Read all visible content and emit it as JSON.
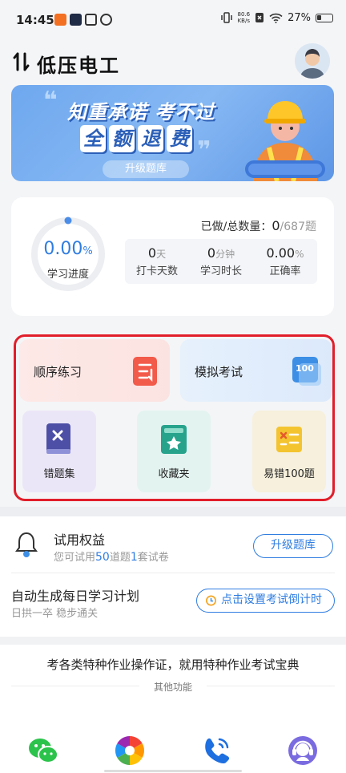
{
  "status_bar": {
    "time": "14:45",
    "speed_value": "80.6",
    "speed_unit": "KB/s",
    "battery": "27%"
  },
  "header": {
    "title": "低压电工"
  },
  "banner": {
    "line1": "知重承诺 考不过",
    "line2": [
      "全",
      "额",
      "退",
      "费"
    ],
    "button": "升级题库"
  },
  "progress": {
    "percent_value": "0.00",
    "percent_unit": "%",
    "label": "学习进度",
    "count_label": "已做/总数量：",
    "done": "0",
    "total": "/687题",
    "stats": [
      {
        "value": "0",
        "unit": "天",
        "label": "打卡天数"
      },
      {
        "value": "0",
        "unit": "分钟",
        "label": "学习时长"
      },
      {
        "value": "0.00",
        "unit": "%",
        "label": "正确率"
      }
    ]
  },
  "modules": {
    "sequential": "顺序练习",
    "mock_exam": "模拟考试",
    "wrong_set": "错题集",
    "favorites": "收藏夹",
    "easy_wrong": "易错100题"
  },
  "trial": {
    "title": "试用权益",
    "sub_prefix": "您可试用",
    "sub_questions": "50",
    "sub_mid": "道题",
    "sub_papers": "1",
    "sub_suffix": "套试卷",
    "upgrade_button": "升级题库"
  },
  "plan": {
    "title": "自动生成每日学习计划",
    "sub": "日拱一卒 稳步通关",
    "countdown_button": "点击设置考试倒计时"
  },
  "footer": {
    "slogan": "考各类特种作业操作证，就用特种作业考试宝典",
    "other_label": "其他功能"
  },
  "colors": {
    "accent": "#2f7de1",
    "highlight_border": "#e11e2a"
  }
}
